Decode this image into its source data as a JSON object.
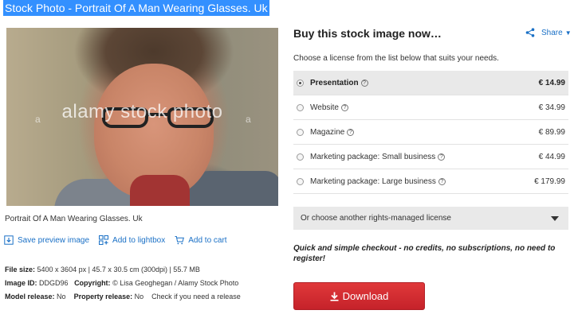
{
  "page": {
    "title": "Stock Photo - Portrait Of A Man Wearing Glasses. Uk"
  },
  "image": {
    "watermark": "alamy stock photo",
    "watermark_mark": "a",
    "caption": "Portrait Of A Man Wearing Glasses. Uk"
  },
  "actions": [
    {
      "label": "Save preview image",
      "icon": "download-icon"
    },
    {
      "label": "Add to lightbox",
      "icon": "lightbox-icon"
    },
    {
      "label": "Add to cart",
      "icon": "cart-icon"
    }
  ],
  "meta": {
    "file_size_label": "File size:",
    "file_size_value": "5400 x 3604 px | 45.7 x 30.5 cm (300dpi) | 55.7 MB",
    "image_id_label": "Image ID:",
    "image_id_value": "DDGD96",
    "copyright_label": "Copyright:",
    "copyright_value": "© Lisa Geoghegan / Alamy Stock Photo",
    "model_release_label": "Model release:",
    "model_release_value": "No",
    "property_release_label": "Property release:",
    "property_release_value": "No",
    "check_text": "Check if you need a release"
  },
  "buy": {
    "title": "Buy this stock image now…",
    "share_label": "Share",
    "share_chevron": "▼",
    "license_hint": "Choose a license from the list below that suits your needs.",
    "info_icon": "?",
    "licenses": [
      {
        "name": "Presentation",
        "price": "€ 14.99",
        "selected": true
      },
      {
        "name": "Website",
        "price": "€ 34.99",
        "selected": false
      },
      {
        "name": "Magazine",
        "price": "€ 89.99",
        "selected": false
      },
      {
        "name": "Marketing package: Small business",
        "price": "€ 44.99",
        "selected": false
      },
      {
        "name": "Marketing package: Large business",
        "price": "€ 179.99",
        "selected": false
      }
    ],
    "rights_managed_label": "Or choose another rights-managed license",
    "checkout_text": "Quick and simple checkout - no credits, no subscriptions, no need to register!",
    "download_label": "Download"
  },
  "colors": {
    "title_highlight": "#3390ff",
    "link": "#1a70c6",
    "download_button": "#d42e33",
    "selected_row": "#e9e9e9"
  }
}
